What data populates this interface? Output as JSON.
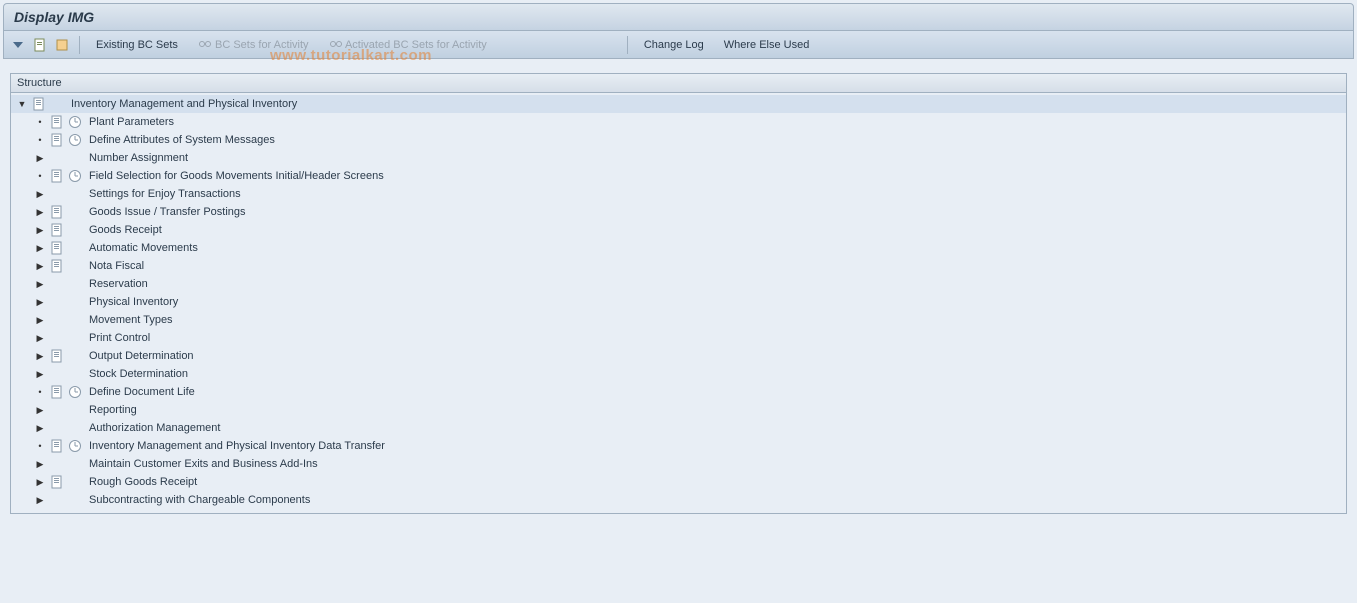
{
  "title": "Display IMG",
  "toolbar": {
    "existing_bc_sets": "Existing BC Sets",
    "bc_sets_for_activity": "BC Sets for Activity",
    "activated_bc_sets": "Activated BC Sets for Activity",
    "change_log": "Change Log",
    "where_else_used": "Where Else Used"
  },
  "watermark": "www.tutorialkart.com",
  "structure_header": "Structure",
  "tree": {
    "root": {
      "label": "Inventory Management and Physical Inventory",
      "expanded": true,
      "hasDoc": true
    },
    "children": [
      {
        "label": "Plant Parameters",
        "hasDoc": true,
        "hasExec": true,
        "leaf": true
      },
      {
        "label": "Define Attributes of System Messages",
        "hasDoc": true,
        "hasExec": true,
        "leaf": true
      },
      {
        "label": "Number Assignment",
        "hasDoc": false,
        "hasExec": false,
        "leaf": false
      },
      {
        "label": "Field Selection for Goods Movements Initial/Header Screens",
        "hasDoc": true,
        "hasExec": true,
        "leaf": true
      },
      {
        "label": "Settings for Enjoy Transactions",
        "hasDoc": false,
        "hasExec": false,
        "leaf": false
      },
      {
        "label": "Goods Issue / Transfer Postings",
        "hasDoc": true,
        "hasExec": false,
        "leaf": false
      },
      {
        "label": "Goods Receipt",
        "hasDoc": true,
        "hasExec": false,
        "leaf": false
      },
      {
        "label": "Automatic Movements",
        "hasDoc": true,
        "hasExec": false,
        "leaf": false
      },
      {
        "label": "Nota Fiscal",
        "hasDoc": true,
        "hasExec": false,
        "leaf": false
      },
      {
        "label": "Reservation",
        "hasDoc": false,
        "hasExec": false,
        "leaf": false
      },
      {
        "label": "Physical Inventory",
        "hasDoc": false,
        "hasExec": false,
        "leaf": false
      },
      {
        "label": "Movement Types",
        "hasDoc": false,
        "hasExec": false,
        "leaf": false
      },
      {
        "label": "Print Control",
        "hasDoc": false,
        "hasExec": false,
        "leaf": false
      },
      {
        "label": "Output Determination",
        "hasDoc": true,
        "hasExec": false,
        "leaf": false
      },
      {
        "label": "Stock Determination",
        "hasDoc": false,
        "hasExec": false,
        "leaf": false
      },
      {
        "label": "Define Document Life",
        "hasDoc": true,
        "hasExec": true,
        "leaf": true
      },
      {
        "label": "Reporting",
        "hasDoc": false,
        "hasExec": false,
        "leaf": false
      },
      {
        "label": "Authorization Management",
        "hasDoc": false,
        "hasExec": false,
        "leaf": false
      },
      {
        "label": "Inventory Management and Physical Inventory Data Transfer",
        "hasDoc": true,
        "hasExec": true,
        "leaf": true
      },
      {
        "label": "Maintain Customer Exits and Business Add-Ins",
        "hasDoc": false,
        "hasExec": false,
        "leaf": false
      },
      {
        "label": "Rough Goods Receipt",
        "hasDoc": true,
        "hasExec": false,
        "leaf": false
      },
      {
        "label": "Subcontracting with Chargeable Components",
        "hasDoc": false,
        "hasExec": false,
        "leaf": false
      }
    ]
  }
}
